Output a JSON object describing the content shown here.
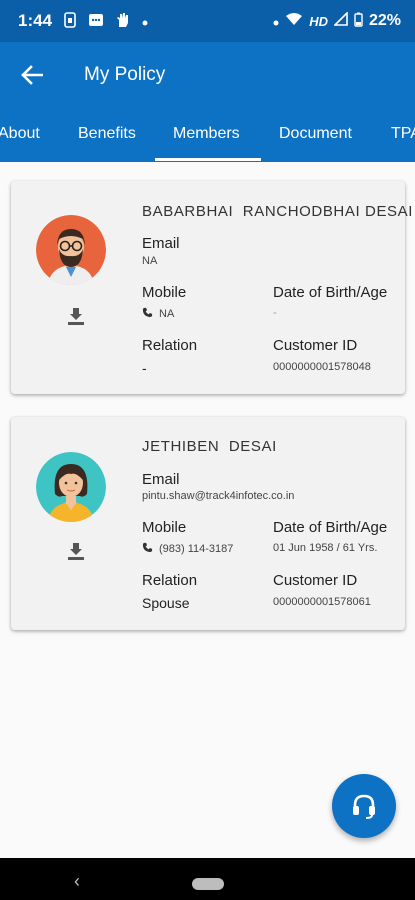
{
  "status_bar": {
    "time": "1:44",
    "network_label": "HD",
    "battery": "22%",
    "icons": [
      "sim-icon",
      "message-icon",
      "hand-icon",
      "dot-icon",
      "wifi-icon",
      "signal-icon",
      "battery-icon"
    ]
  },
  "app_bar": {
    "title": "My Policy",
    "back_icon": "arrow-left-icon"
  },
  "tabs": [
    {
      "label": "About",
      "selected": false
    },
    {
      "label": "Benefits",
      "selected": false
    },
    {
      "label": "Members",
      "selected": true
    },
    {
      "label": "Document",
      "selected": false
    },
    {
      "label": "TPA",
      "selected": false
    }
  ],
  "members": [
    {
      "name": "BABARBHAI  RANCHODBHAI DESAI",
      "avatar": "male-avatar",
      "email_label": "Email",
      "email": "NA",
      "mobile_label": "Mobile",
      "mobile": "NA",
      "dob_label": "Date of Birth/Age",
      "dob": "-",
      "relation_label": "Relation",
      "relation": "-",
      "customer_id_label": "Customer ID",
      "customer_id": "0000000001578048"
    },
    {
      "name": "JETHIBEN  DESAI",
      "avatar": "female-avatar",
      "email_label": "Email",
      "email": "pintu.shaw@track4infotec.co.in",
      "mobile_label": "Mobile",
      "mobile": "(983) 114-3187",
      "dob_label": "Date of Birth/Age",
      "dob": "01 Jun 1958 / 61 Yrs.",
      "relation_label": "Relation",
      "relation": "Spouse",
      "customer_id_label": "Customer ID",
      "customer_id": "0000000001578061"
    }
  ],
  "colors": {
    "status_bar": "#0a5fa8",
    "primary": "#0d72c4",
    "card": "#f2f2f2",
    "male_avatar_bg": "#e8643c",
    "female_avatar_bg": "#3fc4c4"
  }
}
